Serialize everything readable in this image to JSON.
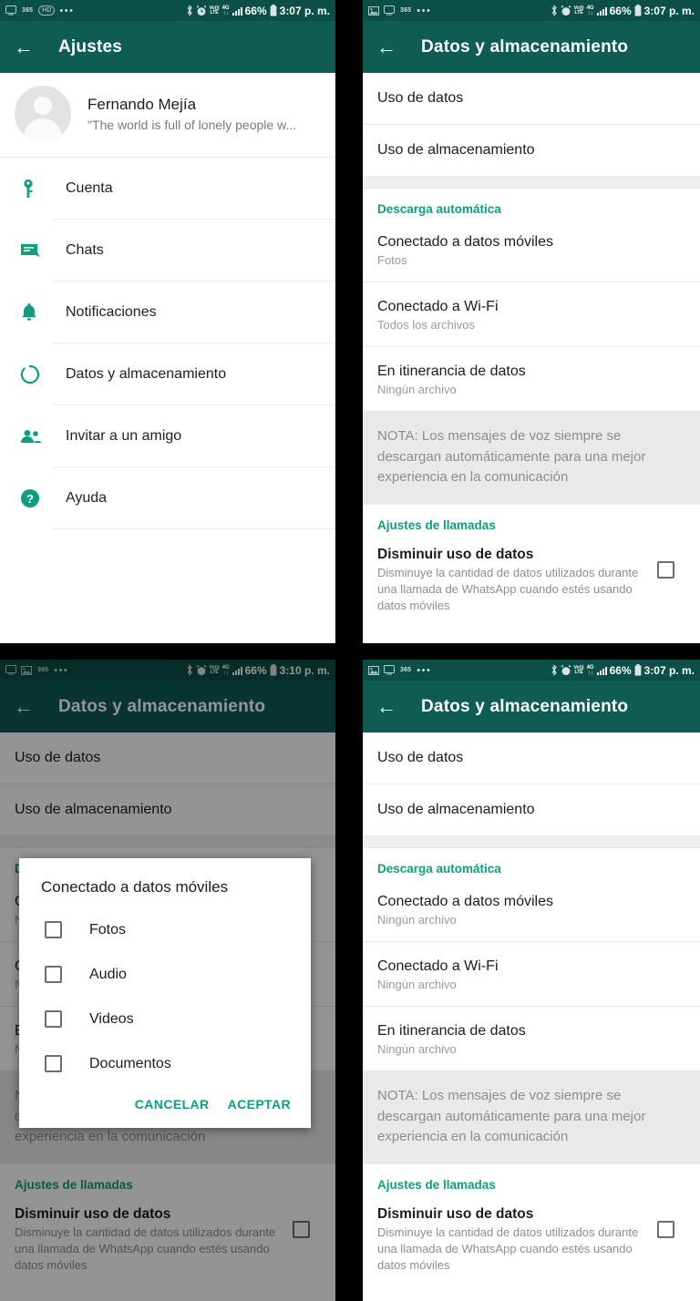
{
  "brand": {
    "header_green": "#0e5c52",
    "status_green": "#0b4f46",
    "accent_teal": "#0f9d7e",
    "note_bg": "#e9e9e9"
  },
  "status_bar": {
    "icons_left": [
      "monitor-icon",
      "image-icon",
      "365-badge",
      "hd-badge",
      "overflow-dots"
    ],
    "badge_365": "365",
    "badge_hd": "HD",
    "dots": "•••",
    "bluetooth": "bluetooth-icon",
    "alarm": "alarm-icon",
    "volte_top": "Vo)))",
    "volte_bottom": "LTE",
    "network_top": "4G",
    "network_bottom": "↑↓",
    "signal": "signal-bars-icon",
    "battery_percent": "66%",
    "battery": "battery-icon",
    "time_0307": "3:07 p. m.",
    "time_0310": "3:10 p. m."
  },
  "panels": {
    "settings": {
      "appbar": {
        "back": "←",
        "title": "Ajustes"
      },
      "profile": {
        "avatar": "default-avatar",
        "name": "Fernando Mejía",
        "status": "\"The world is full of lonely people w..."
      },
      "items": [
        {
          "icon": "key-icon",
          "label": "Cuenta"
        },
        {
          "icon": "chat-icon",
          "label": "Chats"
        },
        {
          "icon": "bell-icon",
          "label": "Notificaciones"
        },
        {
          "icon": "data-storage-icon",
          "label": "Datos y almacenamiento"
        },
        {
          "icon": "people-icon",
          "label": "Invitar a un amigo"
        },
        {
          "icon": "help-icon",
          "label": "Ayuda"
        }
      ]
    },
    "data_storage_a": {
      "appbar": {
        "back": "←",
        "title": "Datos y almacenamiento"
      },
      "top_items": [
        "Uso de datos",
        "Uso de almacenamiento"
      ],
      "section_download": "Descarga automática",
      "download_items": [
        {
          "title": "Conectado a datos móviles",
          "sub": "Fotos"
        },
        {
          "title": "Conectado a Wi-Fi",
          "sub": "Todos los archivos"
        },
        {
          "title": "En itinerancia de datos",
          "sub": "Ningún archivo"
        }
      ],
      "note": "NOTA: Los mensajes de voz siempre se descargan automáticamente para una mejor experiencia en la comunicación",
      "section_calls": "Ajustes de llamadas",
      "call_setting": {
        "title": "Disminuir uso de datos",
        "sub": "Disminuye la cantidad de datos utilizados durante una llamada de WhatsApp cuando estés usando datos móviles",
        "checked": false
      }
    },
    "data_storage_dialog": {
      "appbar": {
        "back": "←",
        "title": "Datos y almacenamiento"
      },
      "top_items": [
        "Uso de datos",
        "Uso de almacenamiento"
      ],
      "section_download": "Descarga automática",
      "download_items": [
        {
          "title": "Conectado a datos móviles",
          "sub": "Ningún archivo"
        },
        {
          "title": "Conectado a Wi-Fi",
          "sub": "Ningún archivo"
        },
        {
          "title": "En itinerancia de datos",
          "sub": "Ningún archivo"
        }
      ],
      "note": "NOTA: Los mensajes de voz siempre se descargan automáticamente para una mejor experiencia en la comunicación",
      "section_calls": "Ajustes de llamadas",
      "call_setting": {
        "title": "Disminuir uso de datos",
        "sub": "Disminuye la cantidad de datos utilizados durante una llamada de WhatsApp cuando estés usando datos móviles",
        "checked": false
      },
      "dialog": {
        "title": "Conectado a datos móviles",
        "options": [
          {
            "label": "Fotos",
            "checked": false
          },
          {
            "label": "Audio",
            "checked": false
          },
          {
            "label": "Videos",
            "checked": false
          },
          {
            "label": "Documentos",
            "checked": false
          }
        ],
        "cancel": "CANCELAR",
        "accept": "ACEPTAR"
      }
    },
    "data_storage_b": {
      "appbar": {
        "back": "←",
        "title": "Datos y almacenamiento"
      },
      "top_items": [
        "Uso de datos",
        "Uso de almacenamiento"
      ],
      "section_download": "Descarga automática",
      "download_items": [
        {
          "title": "Conectado a datos móviles",
          "sub": "Ningún archivo"
        },
        {
          "title": "Conectado a Wi-Fi",
          "sub": "Ningún archivo"
        },
        {
          "title": "En itinerancia de datos",
          "sub": "Ningún archivo"
        }
      ],
      "note": "NOTA: Los mensajes de voz siempre se descargan automáticamente para una mejor experiencia en la comunicación",
      "section_calls": "Ajustes de llamadas",
      "call_setting": {
        "title": "Disminuir uso de datos",
        "sub": "Disminuye la cantidad de datos utilizados durante una llamada de WhatsApp cuando estés usando datos móviles",
        "checked": false
      }
    }
  }
}
